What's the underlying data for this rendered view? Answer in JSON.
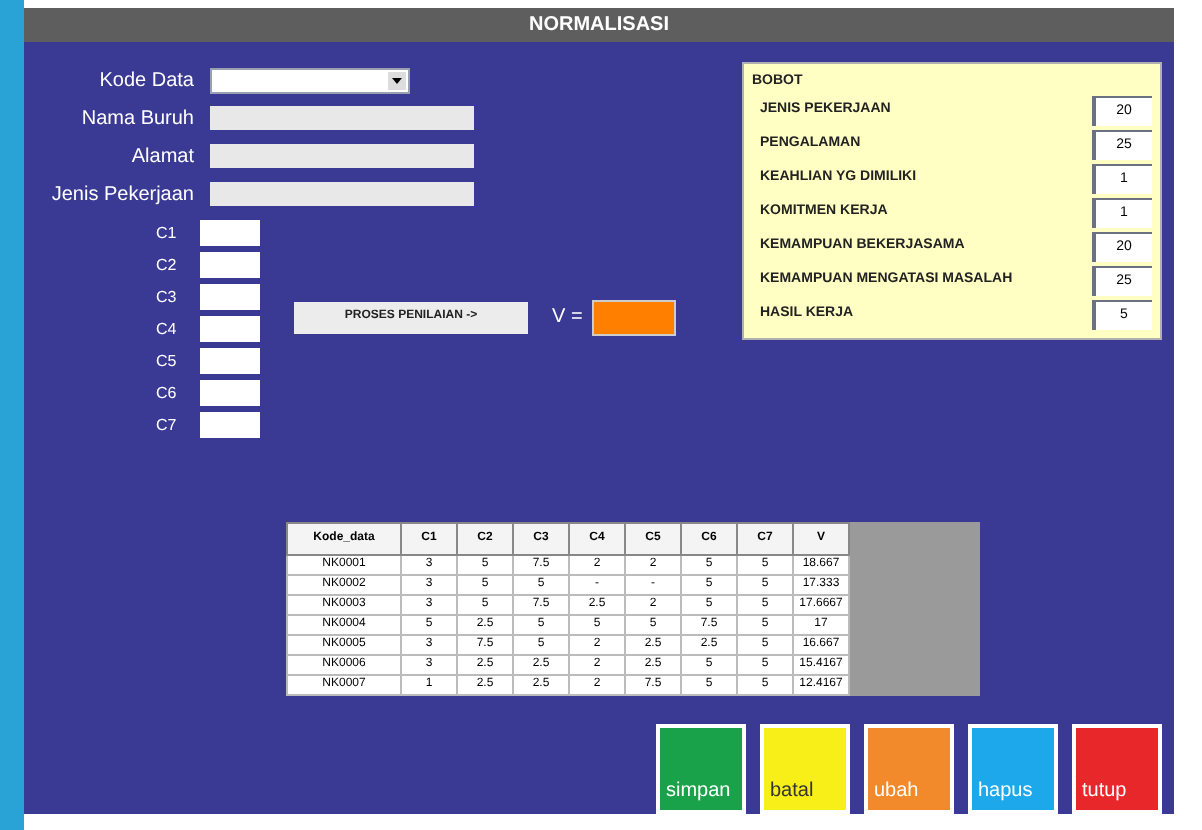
{
  "window": {
    "title": "NORMALISASI"
  },
  "form": [
    {
      "label": "Kode Data",
      "kind": "dropdown"
    },
    {
      "label": "Nama Buruh",
      "kind": "text"
    },
    {
      "label": "Alamat",
      "kind": "text"
    },
    {
      "label": "Jenis Pekerjaan",
      "kind": "text"
    }
  ],
  "criteria": [
    "C1",
    "C2",
    "C3",
    "C4",
    "C5",
    "C6",
    "C7"
  ],
  "process_button": "PROSES PENILAIAN ->",
  "result_label": "V =",
  "bobot": {
    "title": "BOBOT",
    "items": [
      {
        "label": "JENIS PEKERJAAN",
        "value": "20"
      },
      {
        "label": "PENGALAMAN",
        "value": "25"
      },
      {
        "label": "KEAHLIAN YG DIMILIKI",
        "value": "1"
      },
      {
        "label": "KOMITMEN KERJA",
        "value": "1"
      },
      {
        "label": "KEMAMPUAN BEKERJASAMA",
        "value": "20"
      },
      {
        "label": "KEMAMPUAN MENGATASI MASALAH",
        "value": "25"
      },
      {
        "label": "HASIL KERJA",
        "value": "5"
      }
    ]
  },
  "table": {
    "columns": [
      "Kode_data",
      "C1",
      "C2",
      "C3",
      "C4",
      "C5",
      "C6",
      "C7",
      "V"
    ],
    "rows": [
      [
        "NK0001",
        "3",
        "5",
        "7.5",
        "2",
        "2",
        "5",
        "5",
        "18.667"
      ],
      [
        "NK0002",
        "3",
        "5",
        "5",
        "-",
        "-",
        "5",
        "5",
        "17.333"
      ],
      [
        "NK0003",
        "3",
        "5",
        "7.5",
        "2.5",
        "2",
        "5",
        "5",
        "17.6667"
      ],
      [
        "NK0004",
        "5",
        "2.5",
        "5",
        "5",
        "5",
        "7.5",
        "5",
        "17"
      ],
      [
        "NK0005",
        "3",
        "7.5",
        "5",
        "2",
        "2.5",
        "2.5",
        "5",
        "16.667"
      ],
      [
        "NK0006",
        "3",
        "2.5",
        "2.5",
        "2",
        "2.5",
        "5",
        "5",
        "15.4167"
      ],
      [
        "NK0007",
        "1",
        "2.5",
        "2.5",
        "2",
        "7.5",
        "5",
        "5",
        "12.4167"
      ]
    ]
  },
  "buttons": [
    {
      "label": "simpan",
      "color": "#1aa24a"
    },
    {
      "label": "batal",
      "color": "#f7ef17"
    },
    {
      "label": "ubah",
      "color": "#f2892a"
    },
    {
      "label": "hapus",
      "color": "#1ea8ec"
    },
    {
      "label": "tutup",
      "color": "#e8272a"
    }
  ]
}
